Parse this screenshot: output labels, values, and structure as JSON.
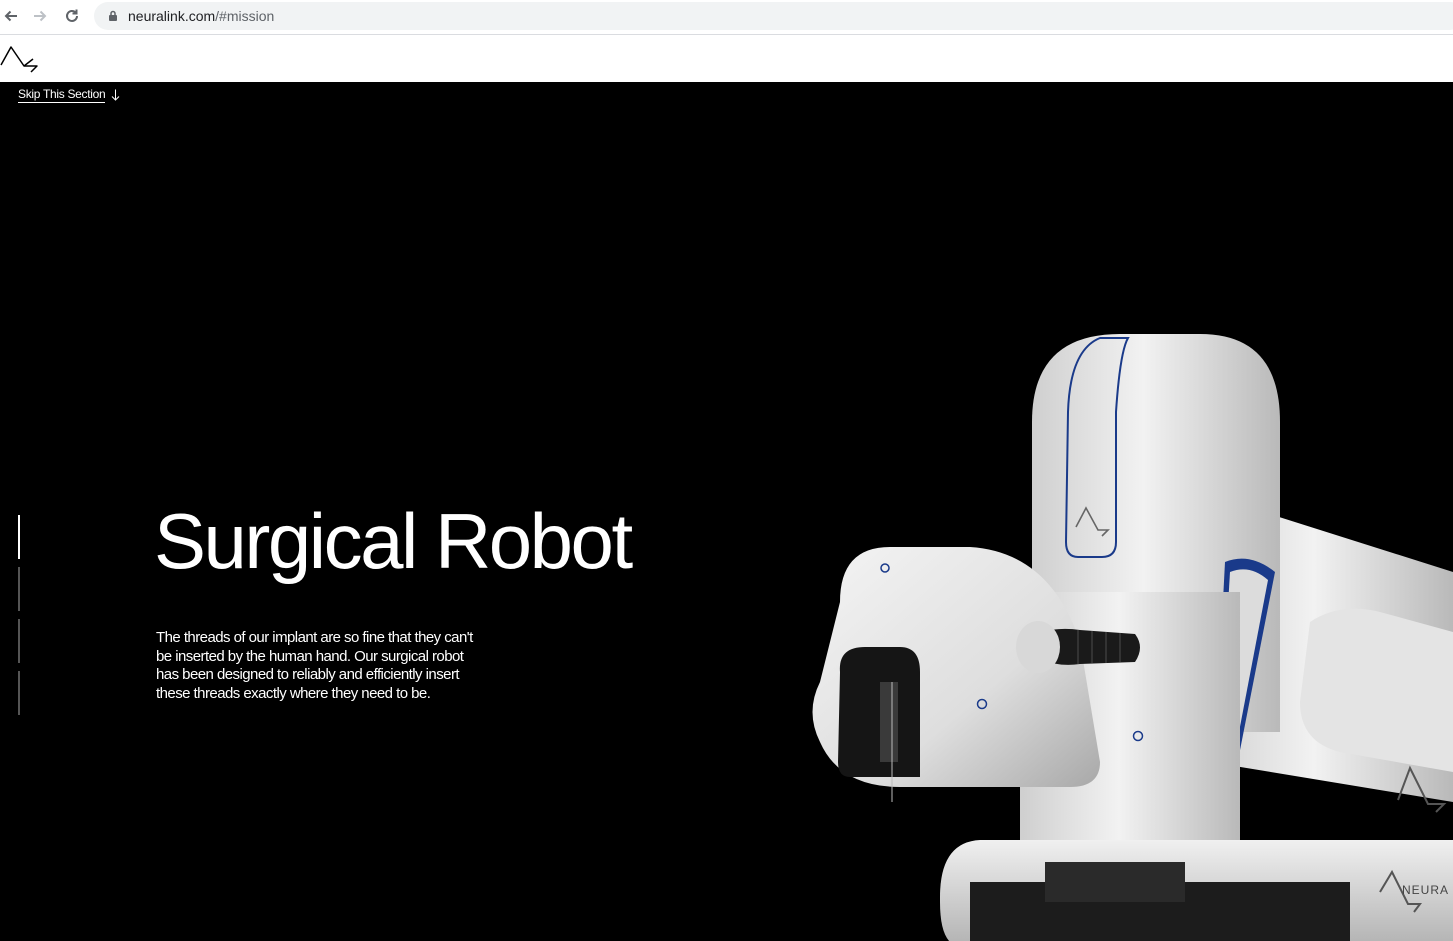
{
  "browser": {
    "url_domain": "neuralink.com",
    "url_path": "/#mission"
  },
  "hero": {
    "skip_label": "Skip This Section",
    "title": "Surgical Robot",
    "description": "The threads of our implant are so fine that they can't be inserted by the human hand. Our surgical robot has been designed to reliably and efficiently insert these threads exactly where they need to be.",
    "section_indicators": [
      {
        "active": true
      },
      {
        "active": false
      },
      {
        "active": false
      },
      {
        "active": false
      }
    ],
    "robot_brand_text": "NEURA"
  },
  "colors": {
    "background": "#000000",
    "text": "#ffffff",
    "robot_body": "#e8e8e8",
    "robot_accent": "#1a3a8a"
  }
}
